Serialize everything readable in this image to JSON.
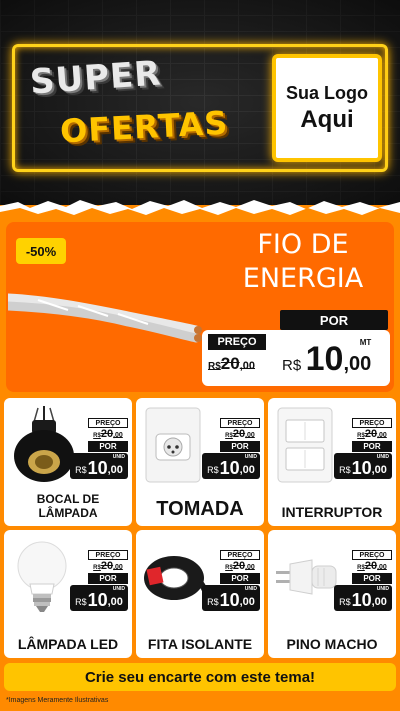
{
  "header": {
    "title_top": "SUPER",
    "title_bottom": "OFERTAS",
    "logo_line1": "Sua Logo",
    "logo_line2": "Aqui"
  },
  "featured": {
    "discount": "-50%",
    "name_line1": "FIO DE",
    "name_line2": "ENERGIA",
    "por_label": "POR",
    "preco_label": "PREÇO",
    "old_currency": "R$",
    "old_int": "20",
    "old_dec": ",00",
    "new_currency": "R$",
    "new_int": "10",
    "new_dec": ",00",
    "unit": "MT"
  },
  "products": [
    {
      "name_line1": "BOCAL DE",
      "name_line2": "LÂMPADA",
      "preco_label": "PREÇO",
      "old_currency": "R$",
      "old_int": "20",
      "old_dec": ",00",
      "por_label": "POR",
      "new_currency": "R$",
      "new_int": "10",
      "new_dec": ",00",
      "unit": "UNID"
    },
    {
      "name_line1": "TOMADA",
      "preco_label": "PREÇO",
      "old_currency": "R$",
      "old_int": "20",
      "old_dec": ",00",
      "por_label": "POR",
      "new_currency": "R$",
      "new_int": "10",
      "new_dec": ",00",
      "unit": "UNID"
    },
    {
      "name_line1": "INTERRUPTOR",
      "preco_label": "PREÇO",
      "old_currency": "R$",
      "old_int": "20",
      "old_dec": ",00",
      "por_label": "POR",
      "new_currency": "R$",
      "new_int": "10",
      "new_dec": ",00",
      "unit": "UNID"
    },
    {
      "name_line1": "LÂMPADA LED",
      "preco_label": "PREÇO",
      "old_currency": "R$",
      "old_int": "20",
      "old_dec": ",00",
      "por_label": "POR",
      "new_currency": "R$",
      "new_int": "10",
      "new_dec": ",00",
      "unit": "UNID"
    },
    {
      "name_line1": "FITA ISOLANTE",
      "preco_label": "PREÇO",
      "old_currency": "R$",
      "old_int": "20",
      "old_dec": ",00",
      "por_label": "POR",
      "new_currency": "R$",
      "new_int": "10",
      "new_dec": ",00",
      "unit": "UNID"
    },
    {
      "name_line1": "PINO MACHO",
      "preco_label": "PREÇO",
      "old_currency": "R$",
      "old_int": "20",
      "old_dec": ",00",
      "por_label": "POR",
      "new_currency": "R$",
      "new_int": "10",
      "new_dec": ",00",
      "unit": "UNID"
    }
  ],
  "footer": {
    "cta": "Crie seu encarte com este tema!",
    "disclaimer": "*Imagens Meramente Ilustrativas"
  },
  "colors": {
    "brand_orange": "#ff6a00",
    "background_orange": "#ff8a00",
    "neon_yellow": "#ffc400",
    "dark": "#111111"
  },
  "icons": [
    "bulb-socket-icon",
    "power-outlet-icon",
    "light-switch-icon",
    "led-bulb-icon",
    "insulating-tape-icon",
    "plug-icon",
    "wire-icon"
  ]
}
